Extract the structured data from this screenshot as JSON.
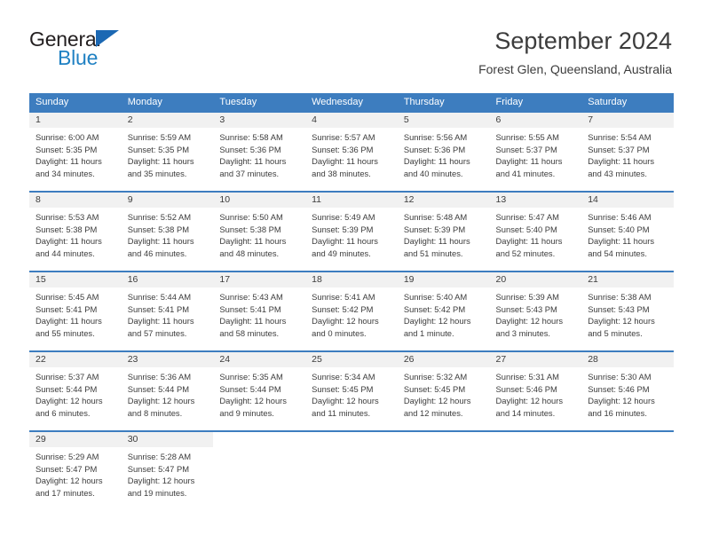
{
  "brand": {
    "name_part1": "General",
    "name_part2": "Blue"
  },
  "header": {
    "title": "September 2024",
    "subtitle": "Forest Glen, Queensland, Australia"
  },
  "colors": {
    "header_blue": "#3d7dbf",
    "brand_blue": "#2081c3",
    "day_band": "#f1f1f1",
    "text": "#3c3c3c"
  },
  "weekdays": [
    "Sunday",
    "Monday",
    "Tuesday",
    "Wednesday",
    "Thursday",
    "Friday",
    "Saturday"
  ],
  "weeks": [
    {
      "days": [
        {
          "number": "1",
          "sunrise": "Sunrise: 6:00 AM",
          "sunset": "Sunset: 5:35 PM",
          "daylight": "Daylight: 11 hours and 34 minutes."
        },
        {
          "number": "2",
          "sunrise": "Sunrise: 5:59 AM",
          "sunset": "Sunset: 5:35 PM",
          "daylight": "Daylight: 11 hours and 35 minutes."
        },
        {
          "number": "3",
          "sunrise": "Sunrise: 5:58 AM",
          "sunset": "Sunset: 5:36 PM",
          "daylight": "Daylight: 11 hours and 37 minutes."
        },
        {
          "number": "4",
          "sunrise": "Sunrise: 5:57 AM",
          "sunset": "Sunset: 5:36 PM",
          "daylight": "Daylight: 11 hours and 38 minutes."
        },
        {
          "number": "5",
          "sunrise": "Sunrise: 5:56 AM",
          "sunset": "Sunset: 5:36 PM",
          "daylight": "Daylight: 11 hours and 40 minutes."
        },
        {
          "number": "6",
          "sunrise": "Sunrise: 5:55 AM",
          "sunset": "Sunset: 5:37 PM",
          "daylight": "Daylight: 11 hours and 41 minutes."
        },
        {
          "number": "7",
          "sunrise": "Sunrise: 5:54 AM",
          "sunset": "Sunset: 5:37 PM",
          "daylight": "Daylight: 11 hours and 43 minutes."
        }
      ]
    },
    {
      "days": [
        {
          "number": "8",
          "sunrise": "Sunrise: 5:53 AM",
          "sunset": "Sunset: 5:38 PM",
          "daylight": "Daylight: 11 hours and 44 minutes."
        },
        {
          "number": "9",
          "sunrise": "Sunrise: 5:52 AM",
          "sunset": "Sunset: 5:38 PM",
          "daylight": "Daylight: 11 hours and 46 minutes."
        },
        {
          "number": "10",
          "sunrise": "Sunrise: 5:50 AM",
          "sunset": "Sunset: 5:38 PM",
          "daylight": "Daylight: 11 hours and 48 minutes."
        },
        {
          "number": "11",
          "sunrise": "Sunrise: 5:49 AM",
          "sunset": "Sunset: 5:39 PM",
          "daylight": "Daylight: 11 hours and 49 minutes."
        },
        {
          "number": "12",
          "sunrise": "Sunrise: 5:48 AM",
          "sunset": "Sunset: 5:39 PM",
          "daylight": "Daylight: 11 hours and 51 minutes."
        },
        {
          "number": "13",
          "sunrise": "Sunrise: 5:47 AM",
          "sunset": "Sunset: 5:40 PM",
          "daylight": "Daylight: 11 hours and 52 minutes."
        },
        {
          "number": "14",
          "sunrise": "Sunrise: 5:46 AM",
          "sunset": "Sunset: 5:40 PM",
          "daylight": "Daylight: 11 hours and 54 minutes."
        }
      ]
    },
    {
      "days": [
        {
          "number": "15",
          "sunrise": "Sunrise: 5:45 AM",
          "sunset": "Sunset: 5:41 PM",
          "daylight": "Daylight: 11 hours and 55 minutes."
        },
        {
          "number": "16",
          "sunrise": "Sunrise: 5:44 AM",
          "sunset": "Sunset: 5:41 PM",
          "daylight": "Daylight: 11 hours and 57 minutes."
        },
        {
          "number": "17",
          "sunrise": "Sunrise: 5:43 AM",
          "sunset": "Sunset: 5:41 PM",
          "daylight": "Daylight: 11 hours and 58 minutes."
        },
        {
          "number": "18",
          "sunrise": "Sunrise: 5:41 AM",
          "sunset": "Sunset: 5:42 PM",
          "daylight": "Daylight: 12 hours and 0 minutes."
        },
        {
          "number": "19",
          "sunrise": "Sunrise: 5:40 AM",
          "sunset": "Sunset: 5:42 PM",
          "daylight": "Daylight: 12 hours and 1 minute."
        },
        {
          "number": "20",
          "sunrise": "Sunrise: 5:39 AM",
          "sunset": "Sunset: 5:43 PM",
          "daylight": "Daylight: 12 hours and 3 minutes."
        },
        {
          "number": "21",
          "sunrise": "Sunrise: 5:38 AM",
          "sunset": "Sunset: 5:43 PM",
          "daylight": "Daylight: 12 hours and 5 minutes."
        }
      ]
    },
    {
      "days": [
        {
          "number": "22",
          "sunrise": "Sunrise: 5:37 AM",
          "sunset": "Sunset: 5:44 PM",
          "daylight": "Daylight: 12 hours and 6 minutes."
        },
        {
          "number": "23",
          "sunrise": "Sunrise: 5:36 AM",
          "sunset": "Sunset: 5:44 PM",
          "daylight": "Daylight: 12 hours and 8 minutes."
        },
        {
          "number": "24",
          "sunrise": "Sunrise: 5:35 AM",
          "sunset": "Sunset: 5:44 PM",
          "daylight": "Daylight: 12 hours and 9 minutes."
        },
        {
          "number": "25",
          "sunrise": "Sunrise: 5:34 AM",
          "sunset": "Sunset: 5:45 PM",
          "daylight": "Daylight: 12 hours and 11 minutes."
        },
        {
          "number": "26",
          "sunrise": "Sunrise: 5:32 AM",
          "sunset": "Sunset: 5:45 PM",
          "daylight": "Daylight: 12 hours and 12 minutes."
        },
        {
          "number": "27",
          "sunrise": "Sunrise: 5:31 AM",
          "sunset": "Sunset: 5:46 PM",
          "daylight": "Daylight: 12 hours and 14 minutes."
        },
        {
          "number": "28",
          "sunrise": "Sunrise: 5:30 AM",
          "sunset": "Sunset: 5:46 PM",
          "daylight": "Daylight: 12 hours and 16 minutes."
        }
      ]
    },
    {
      "days": [
        {
          "number": "29",
          "sunrise": "Sunrise: 5:29 AM",
          "sunset": "Sunset: 5:47 PM",
          "daylight": "Daylight: 12 hours and 17 minutes."
        },
        {
          "number": "30",
          "sunrise": "Sunrise: 5:28 AM",
          "sunset": "Sunset: 5:47 PM",
          "daylight": "Daylight: 12 hours and 19 minutes."
        },
        {
          "number": "",
          "sunrise": "",
          "sunset": "",
          "daylight": ""
        },
        {
          "number": "",
          "sunrise": "",
          "sunset": "",
          "daylight": ""
        },
        {
          "number": "",
          "sunrise": "",
          "sunset": "",
          "daylight": ""
        },
        {
          "number": "",
          "sunrise": "",
          "sunset": "",
          "daylight": ""
        },
        {
          "number": "",
          "sunrise": "",
          "sunset": "",
          "daylight": ""
        }
      ]
    }
  ]
}
